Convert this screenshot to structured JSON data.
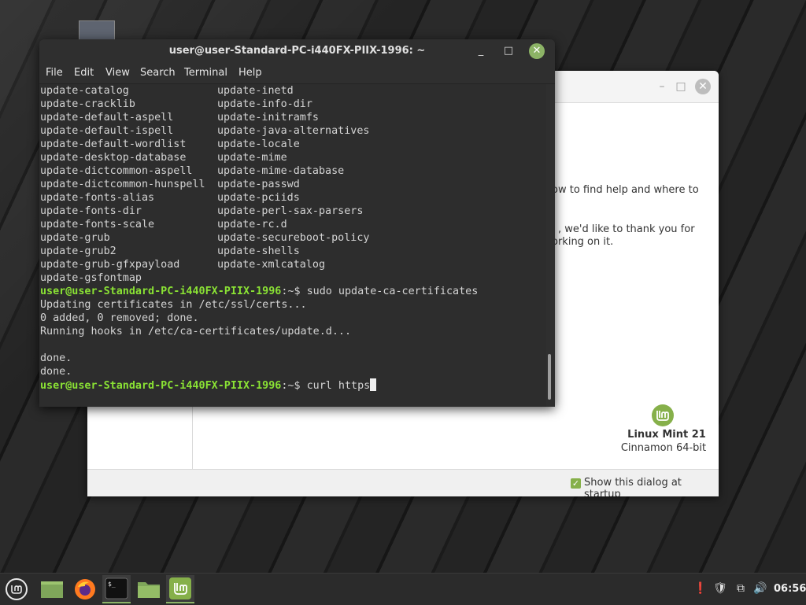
{
  "terminal": {
    "title": "user@user-Standard-PC-i440FX-PIIX-1996: ~",
    "menu": [
      "File",
      "Edit",
      "View",
      "Search",
      "Terminal",
      "Help"
    ],
    "list_left": [
      "update-catalog",
      "update-cracklib",
      "update-default-aspell",
      "update-default-ispell",
      "update-default-wordlist",
      "update-desktop-database",
      "update-dictcommon-aspell",
      "update-dictcommon-hunspell",
      "update-fonts-alias",
      "update-fonts-dir",
      "update-fonts-scale",
      "update-grub",
      "update-grub2",
      "update-grub-gfxpayload",
      "update-gsfontmap"
    ],
    "list_right": [
      "update-inetd",
      "update-info-dir",
      "update-initramfs",
      "update-java-alternatives",
      "update-locale",
      "update-mime",
      "update-mime-database",
      "update-passwd",
      "update-pciids",
      "update-perl-sax-parsers",
      "update-rc.d",
      "update-secureboot-policy",
      "update-shells",
      "update-xmlcatalog"
    ],
    "prompt_user": "user@user-Standard-PC-i440FX-PIIX-1996",
    "prompt_suffix": ":~$ ",
    "command1": "sudo update-ca-certificates",
    "output": [
      "Updating certificates in /etc/ssl/certs...",
      "0 added, 0 removed; done.",
      "Running hooks in /etc/ca-certificates/update.d...",
      "",
      "done.",
      "done."
    ],
    "current_input": "curl https"
  },
  "welcome": {
    "text1": "ow to find help and where to",
    "text2": ", we'd like to thank you for",
    "text3": "orking on it.",
    "distro_name": "Linux Mint 21",
    "edition": "Cinnamon 64-bit",
    "startup_label": "Show this dialog at startup",
    "startup_checked": true
  },
  "taskbar": {
    "clock": "06:56",
    "accent": "#8cb366"
  }
}
